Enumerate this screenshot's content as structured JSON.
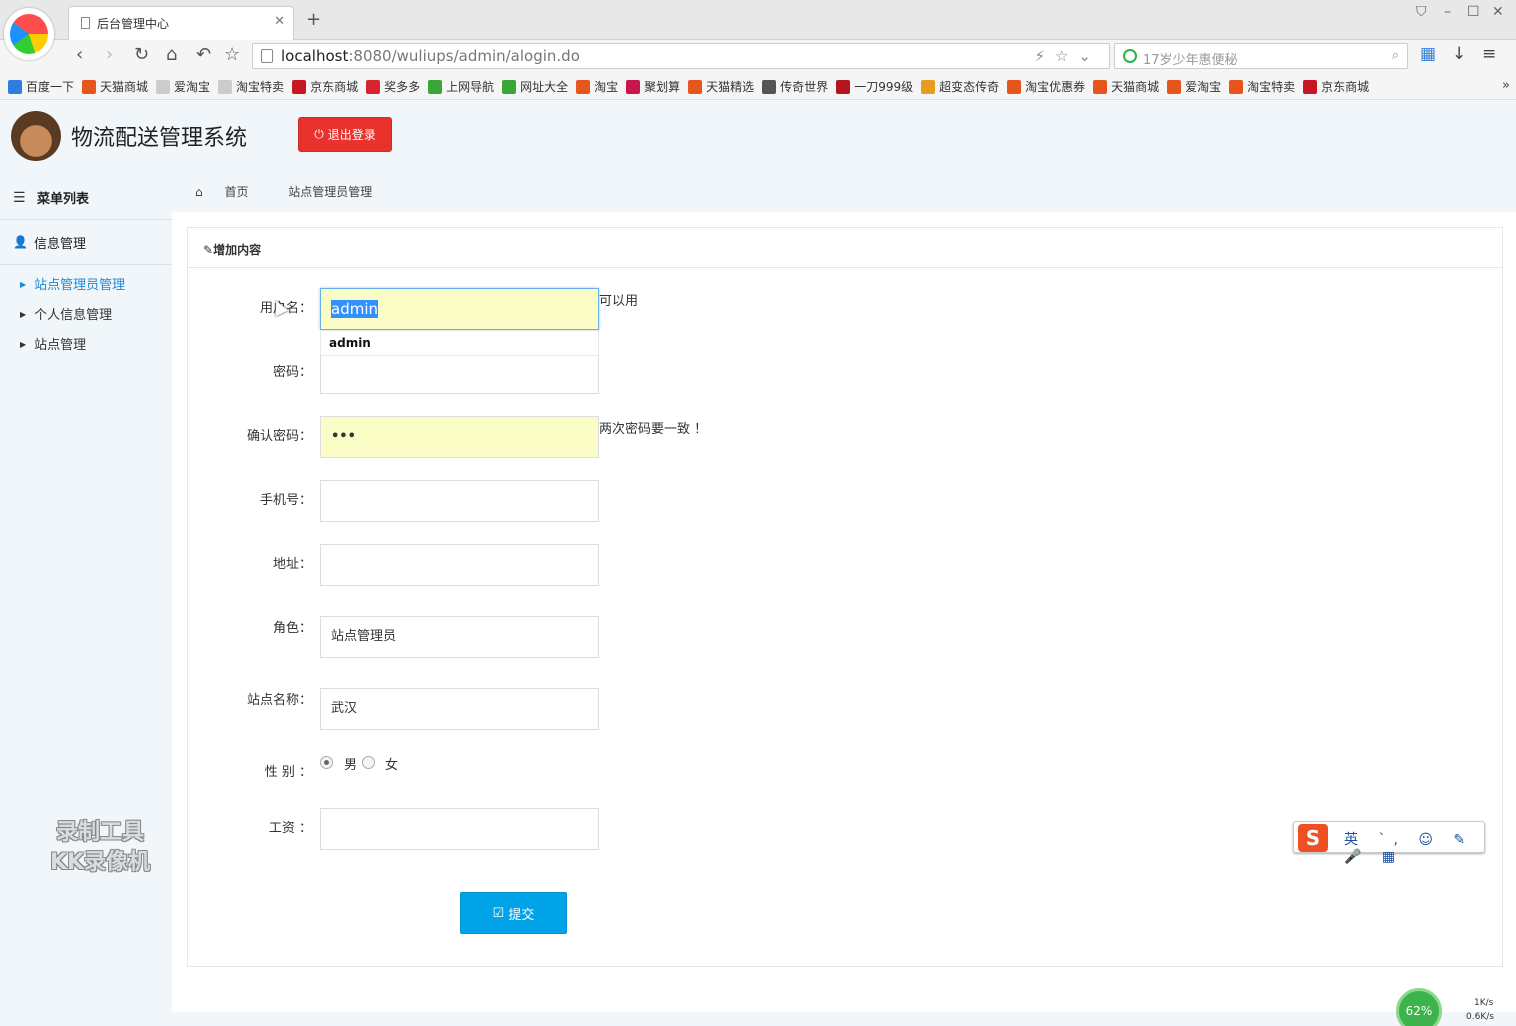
{
  "browser": {
    "tab_title": "后台管理中心",
    "url_host": "localhost",
    "url_path": ":8080/wuliups/admin/alogin.do",
    "search_placeholder": "17岁少年惠便秘",
    "bookmarks": [
      {
        "label": "百度一下",
        "color": "#2f7de1"
      },
      {
        "label": "天猫商城",
        "color": "#e8541e"
      },
      {
        "label": "爱淘宝",
        "color": "#cccccc"
      },
      {
        "label": "淘宝特卖",
        "color": "#cccccc"
      },
      {
        "label": "京东商城",
        "color": "#c91623"
      },
      {
        "label": "奖多多",
        "color": "#d9232e"
      },
      {
        "label": "上网导航",
        "color": "#3aa63a"
      },
      {
        "label": "网址大全",
        "color": "#3aa63a"
      },
      {
        "label": "淘宝",
        "color": "#e8541e"
      },
      {
        "label": "聚划算",
        "color": "#c8164e"
      },
      {
        "label": "天猫精选",
        "color": "#e8541e"
      },
      {
        "label": "传奇世界",
        "color": "#555555"
      },
      {
        "label": "一刀999级",
        "color": "#b3161c"
      },
      {
        "label": "超变态传奇",
        "color": "#e89b1e"
      },
      {
        "label": "淘宝优惠券",
        "color": "#e8541e"
      },
      {
        "label": "天猫商城",
        "color": "#e8541e"
      },
      {
        "label": "爱淘宝",
        "color": "#e8541e"
      },
      {
        "label": "淘宝特卖",
        "color": "#e8541e"
      },
      {
        "label": "京东商城",
        "color": "#c91623"
      }
    ]
  },
  "header": {
    "title": "物流配送管理系统",
    "logout_label": "退出登录"
  },
  "sidebar": {
    "menu_title": "菜单列表",
    "group_title": "信息管理",
    "items": [
      {
        "label": "站点管理员管理",
        "active": true
      },
      {
        "label": "个人信息管理",
        "active": false
      },
      {
        "label": "站点管理",
        "active": false
      }
    ]
  },
  "breadcrumb": {
    "home": "首页",
    "current": "站点管理员管理"
  },
  "panel": {
    "title": "增加内容"
  },
  "form": {
    "username_label": "用户名：",
    "username_value": "admin",
    "username_hint": "可以用",
    "username_suggestion": "admin",
    "password_label": "密码：",
    "confirm_label": "确认密码：",
    "confirm_value": "•••",
    "confirm_hint": "两次密码要一致 ！",
    "phone_label": "手机号：",
    "address_label": "地址：",
    "role_label": "角色：",
    "role_value": "站点管理员",
    "station_label": "站点名称：",
    "station_value": "武汉",
    "gender_label": "性 别 ：",
    "gender_male": "男",
    "gender_female": "女",
    "salary_label": "工资 ：",
    "submit_label": "提交"
  },
  "overlay": {
    "watermark_line1": "录制工具",
    "watermark_line2": "KK录像机",
    "ime_label": "英 ˋ, ☺ ✎ 🎤 ▦",
    "net_percent": "62%",
    "net_up": "1K/s",
    "net_down": "0.6K/s"
  }
}
